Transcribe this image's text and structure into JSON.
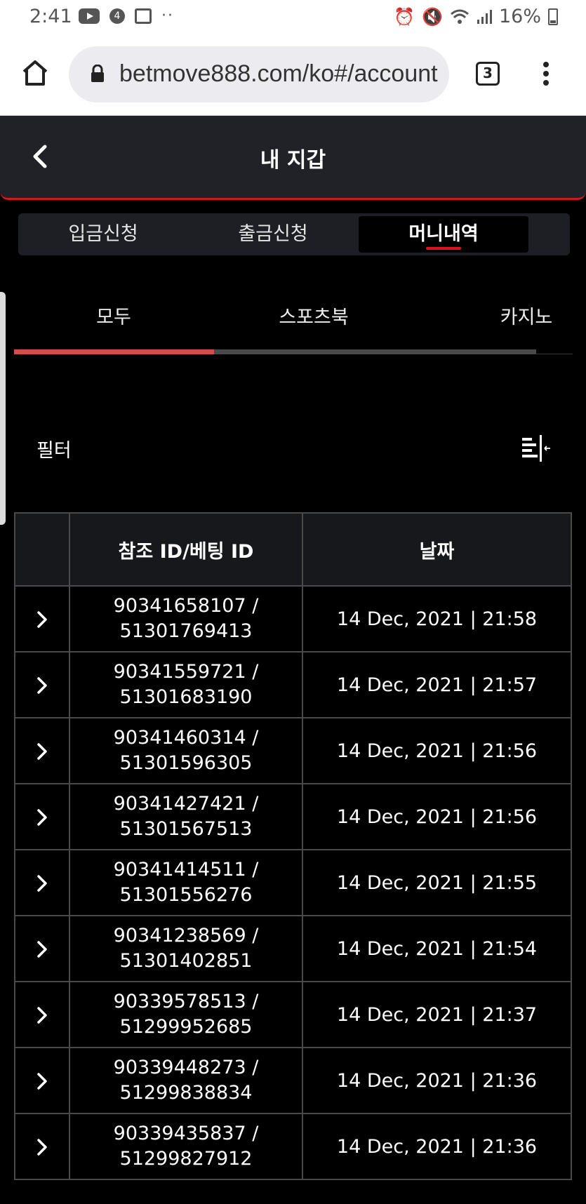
{
  "status_bar": {
    "time": "2:41",
    "notification_count": "4",
    "more": "··",
    "battery": "16%",
    "icons": [
      "youtube-icon",
      "notification-count-icon",
      "gallery-icon",
      "alarm-icon",
      "mute-icon",
      "wifi-icon",
      "signal-icon",
      "battery-charging-icon"
    ]
  },
  "browser": {
    "url": "betmove888.com/ko#/account",
    "tab_count": "3"
  },
  "header": {
    "title": "내 지갑"
  },
  "segment_tabs": [
    {
      "label": "입금신청",
      "active": false
    },
    {
      "label": "출금신청",
      "active": false
    },
    {
      "label": "머니내역",
      "active": true
    }
  ],
  "sub_tabs": [
    {
      "label": "모두",
      "active": true
    },
    {
      "label": "스포츠북",
      "active": false
    },
    {
      "label": "카지노",
      "active": false
    }
  ],
  "filter": {
    "label": "필터"
  },
  "table": {
    "headers": [
      "",
      "참조 ID/베팅 ID",
      "날짜"
    ],
    "rows": [
      {
        "ref_id": "90341658107 /",
        "bet_id": "51301769413",
        "date": "14 Dec, 2021 | 21:58"
      },
      {
        "ref_id": "90341559721 /",
        "bet_id": "51301683190",
        "date": "14 Dec, 2021 | 21:57"
      },
      {
        "ref_id": "90341460314 /",
        "bet_id": "51301596305",
        "date": "14 Dec, 2021 | 21:56"
      },
      {
        "ref_id": "90341427421 /",
        "bet_id": "51301567513",
        "date": "14 Dec, 2021 | 21:56"
      },
      {
        "ref_id": "90341414511 /",
        "bet_id": "51301556276",
        "date": "14 Dec, 2021 | 21:55"
      },
      {
        "ref_id": "90341238569 /",
        "bet_id": "51301402851",
        "date": "14 Dec, 2021 | 21:54"
      },
      {
        "ref_id": "90339578513 /",
        "bet_id": "51299952685",
        "date": "14 Dec, 2021 | 21:37"
      },
      {
        "ref_id": "90339448273 /",
        "bet_id": "51299838834",
        "date": "14 Dec, 2021 | 21:36"
      },
      {
        "ref_id": "90339435837 /",
        "bet_id": "51299827912",
        "date": "14 Dec, 2021 | 21:36"
      }
    ]
  },
  "colors": {
    "accent": "#d7151f",
    "header_bg": "#202228",
    "page_bg": "#000000"
  }
}
